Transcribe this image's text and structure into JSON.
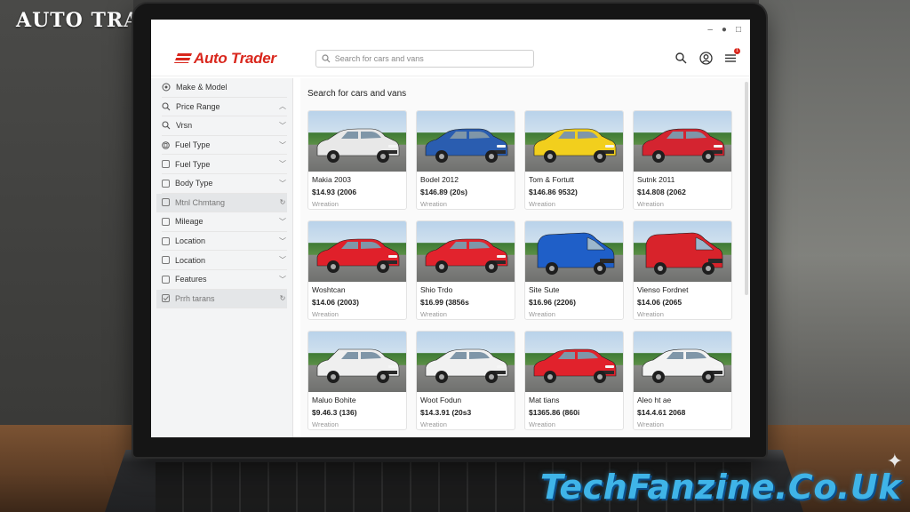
{
  "overlay": {
    "brand": "AUTO TRADER",
    "watermark": "TechFanzine.Co.Uk"
  },
  "header": {
    "logo_text": "Auto Trader",
    "search_placeholder": "Search for cars and vans",
    "icons": [
      "search-icon",
      "user-icon",
      "menu-icon"
    ],
    "notification_count": "1"
  },
  "sidebar": {
    "filters": [
      {
        "label": "Make & Model",
        "icon": "make-icon",
        "chevron": ""
      },
      {
        "label": "Price Range",
        "icon": "search-icon",
        "chevron": "up"
      },
      {
        "label": "Vrsn",
        "icon": "search-icon",
        "chevron": "down"
      },
      {
        "label": "Fuel Type",
        "icon": "fuel-icon",
        "chevron": "down"
      },
      {
        "label": "Fuel Type",
        "icon": "checkbox",
        "chevron": "down"
      },
      {
        "label": "Body Type",
        "icon": "checkbox",
        "chevron": "down"
      },
      {
        "label": "Mtnl Chmtang",
        "icon": "checkbox",
        "chevron": "refresh",
        "shaded": true
      },
      {
        "label": "Mileage",
        "icon": "checkbox",
        "chevron": "down"
      },
      {
        "label": "Location",
        "icon": "checkbox",
        "chevron": "down"
      },
      {
        "label": "Location",
        "icon": "checkbox",
        "chevron": "down"
      },
      {
        "label": "Features",
        "icon": "checkbox",
        "chevron": "down"
      },
      {
        "label": "Prrh tarans",
        "icon": "checkbox-checked",
        "chevron": "refresh",
        "shaded": true
      }
    ]
  },
  "main": {
    "title": "Search for cars and vans",
    "listings": [
      {
        "title": "Makia 2003",
        "price": "$14.93 (2006",
        "location": "Wreation",
        "color": "#e8e8e8",
        "kind": "hatch"
      },
      {
        "title": "Bodel 2012",
        "price": "$146.89 (20s)",
        "location": "Wreation",
        "color": "#2a5db0",
        "kind": "hatch"
      },
      {
        "title": "Tom & Fortutt",
        "price": "$146.86 9532)",
        "location": "Wreation",
        "color": "#f2cf1d",
        "kind": "hatch"
      },
      {
        "title": "Sutnk 2011",
        "price": "$14.808 (2062",
        "location": "Wreation",
        "color": "#d42430",
        "kind": "hatch"
      },
      {
        "title": "Woshtcan",
        "price": "$14.06 (2003)",
        "location": "Wreation",
        "color": "#e0202a",
        "kind": "hatch"
      },
      {
        "title": "Shio Trdo",
        "price": "$16.99 (3856s",
        "location": "Wreation",
        "color": "#e2232d",
        "kind": "hatch"
      },
      {
        "title": "Site Sute",
        "price": "$16.96 (2206)",
        "location": "Wreation",
        "color": "#1f5fc8",
        "kind": "van"
      },
      {
        "title": "Vienso Fordnet",
        "price": "$14.06 (2065",
        "location": "Wreation",
        "color": "#d8232b",
        "kind": "van"
      },
      {
        "title": "Maluo Bohite",
        "price": "$9.46.3 (136)",
        "location": "Wreation",
        "color": "#efefef",
        "kind": "mpv"
      },
      {
        "title": "Woot Fodun",
        "price": "$14.3.91 (20s3",
        "location": "Wreation",
        "color": "#f1f1f1",
        "kind": "hatch"
      },
      {
        "title": "Mat tians",
        "price": "$1365.86 (860i",
        "location": "Wreation",
        "color": "#e1222c",
        "kind": "hatch"
      },
      {
        "title": "Aleo ht ae",
        "price": "$14.4.61 2068",
        "location": "Wreation",
        "color": "#f3f3f3",
        "kind": "hatch"
      }
    ]
  }
}
